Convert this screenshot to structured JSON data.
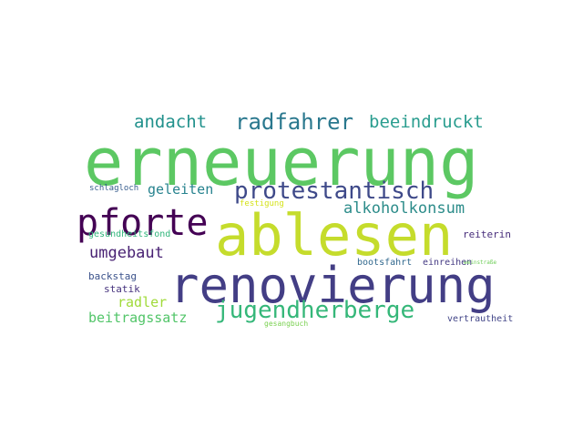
{
  "words": [
    {
      "text": "erneuerung",
      "color": "#5cc863"
    },
    {
      "text": "ablesen",
      "color": "#c5dc2c"
    },
    {
      "text": "renovierung",
      "color": "#433e85"
    },
    {
      "text": "pforte",
      "color": "#440154"
    },
    {
      "text": "protestantisch",
      "color": "#3e4989"
    },
    {
      "text": "jugendherberge",
      "color": "#35b779"
    },
    {
      "text": "radfahrer",
      "color": "#2a788e"
    },
    {
      "text": "beeindruckt",
      "color": "#2a9d8f"
    },
    {
      "text": "andacht",
      "color": "#21918c"
    },
    {
      "text": "alkoholkonsum",
      "color": "#2c8c8a"
    },
    {
      "text": "umgebaut",
      "color": "#482173"
    },
    {
      "text": "geleiten",
      "color": "#26828e"
    },
    {
      "text": "radler",
      "color": "#a0da39"
    },
    {
      "text": "beitragssatz",
      "color": "#52c569"
    },
    {
      "text": "gesundheitsfond",
      "color": "#31b57b"
    },
    {
      "text": "backstag",
      "color": "#3b528b"
    },
    {
      "text": "statik",
      "color": "#46337e"
    },
    {
      "text": "schlagloch",
      "color": "#365c8d"
    },
    {
      "text": "festigung",
      "color": "#d5e21a"
    },
    {
      "text": "gesangbuch",
      "color": "#7ad151"
    },
    {
      "text": "bootsfahrt",
      "color": "#31688e"
    },
    {
      "text": "einreihen",
      "color": "#443a83"
    },
    {
      "text": "weinstraße",
      "color": "#6ece58"
    },
    {
      "text": "reiterin",
      "color": "#472d7b"
    },
    {
      "text": "vertrautheit",
      "color": "#414487"
    }
  ]
}
